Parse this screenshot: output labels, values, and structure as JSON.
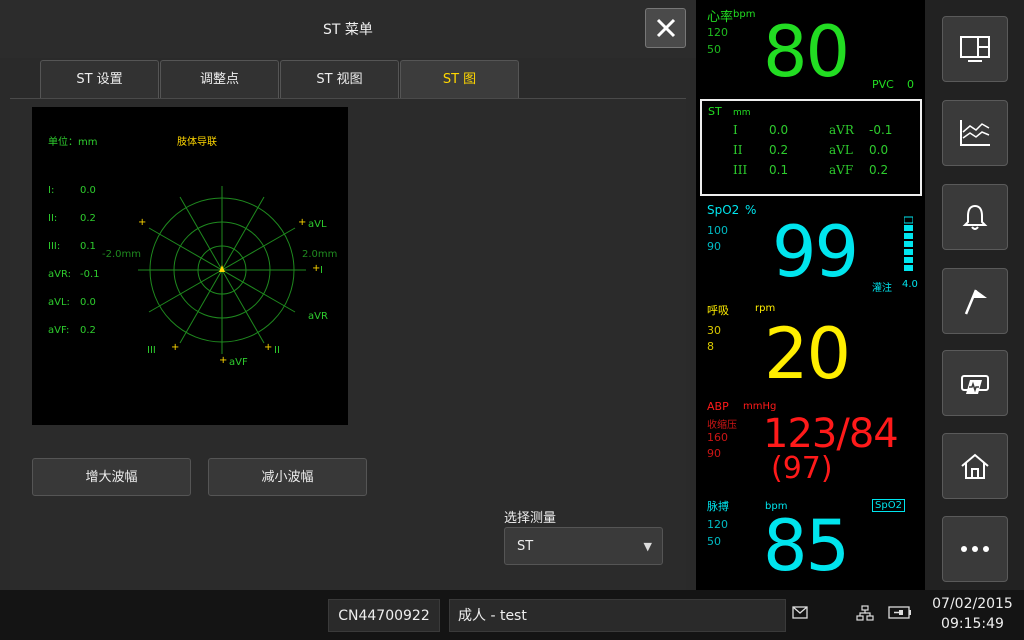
{
  "dialog": {
    "title": "ST 菜单",
    "tabs": [
      {
        "label": "ST 设置"
      },
      {
        "label": "调整点"
      },
      {
        "label": "ST 视图"
      },
      {
        "label": "ST 图",
        "active": true
      }
    ]
  },
  "st_graph": {
    "unit_label": "单位：mm",
    "lead_type": "肢体导联",
    "values": [
      {
        "lead": "I:",
        "value": "0.0"
      },
      {
        "lead": "II:",
        "value": "0.2"
      },
      {
        "lead": "III:",
        "value": "0.1"
      },
      {
        "lead": "aVR:",
        "value": "-0.1"
      },
      {
        "lead": "aVL:",
        "value": "0.0"
      },
      {
        "lead": "aVF:",
        "value": "0.2"
      }
    ],
    "scale_left": "-2.0mm",
    "scale_right": "2.0mm",
    "axis_labels": {
      "aVL": "aVL",
      "I": "I",
      "aVR": "aVR",
      "II": "II",
      "aVF": "aVF",
      "III": "III"
    }
  },
  "buttons": {
    "increase": "增大波幅",
    "decrease": "减小波幅"
  },
  "measure_select": {
    "label": "选择测量",
    "value": "ST"
  },
  "vitals": {
    "hr": {
      "label": "心率",
      "unit": "bpm",
      "high": "120",
      "low": "50",
      "value": "80",
      "pvc_label": "PVC",
      "pvc_value": "0",
      "color": "#22dd22"
    },
    "st": {
      "label": "ST",
      "unit": "mm",
      "rows": [
        {
          "lead1": "I",
          "val1": "0.0",
          "lead2": "aVR",
          "val2": "-0.1"
        },
        {
          "lead1": "II",
          "val1": "0.2",
          "lead2": "aVL",
          "val2": "0.0"
        },
        {
          "lead1": "III",
          "val1": "0.1",
          "lead2": "aVF",
          "val2": "0.2"
        }
      ]
    },
    "spo2": {
      "label": "SpO2",
      "unit": "%",
      "high": "100",
      "low": "90",
      "value": "99",
      "perf_label": "灌注",
      "perf_value": "4.0",
      "bar_level": 0.85,
      "color": "#00e5ee"
    },
    "resp": {
      "label": "呼吸",
      "unit": "rpm",
      "high": "30",
      "low": "8",
      "value": "20",
      "color": "#ffee00"
    },
    "abp": {
      "label": "ABP",
      "unit": "mmHg",
      "sub_label": "收缩压",
      "high": "160",
      "low": "90",
      "value": "123/84",
      "mean": "(97)",
      "color": "#ff1a1a"
    },
    "pulse": {
      "label": "脉搏",
      "unit": "bpm",
      "source": "SpO2",
      "high": "120",
      "low": "50",
      "value": "85",
      "color": "#00e5ee"
    }
  },
  "toolbar": {
    "icons": [
      "layout-icon",
      "trend-icon",
      "alarm-bell-icon",
      "flag-icon",
      "ecg-print-icon",
      "home-icon",
      "more-icon"
    ]
  },
  "statusbar": {
    "device_id": "CN44700922",
    "patient": "成人 - test",
    "date": "07/02/2015",
    "time": "09:15:49"
  }
}
